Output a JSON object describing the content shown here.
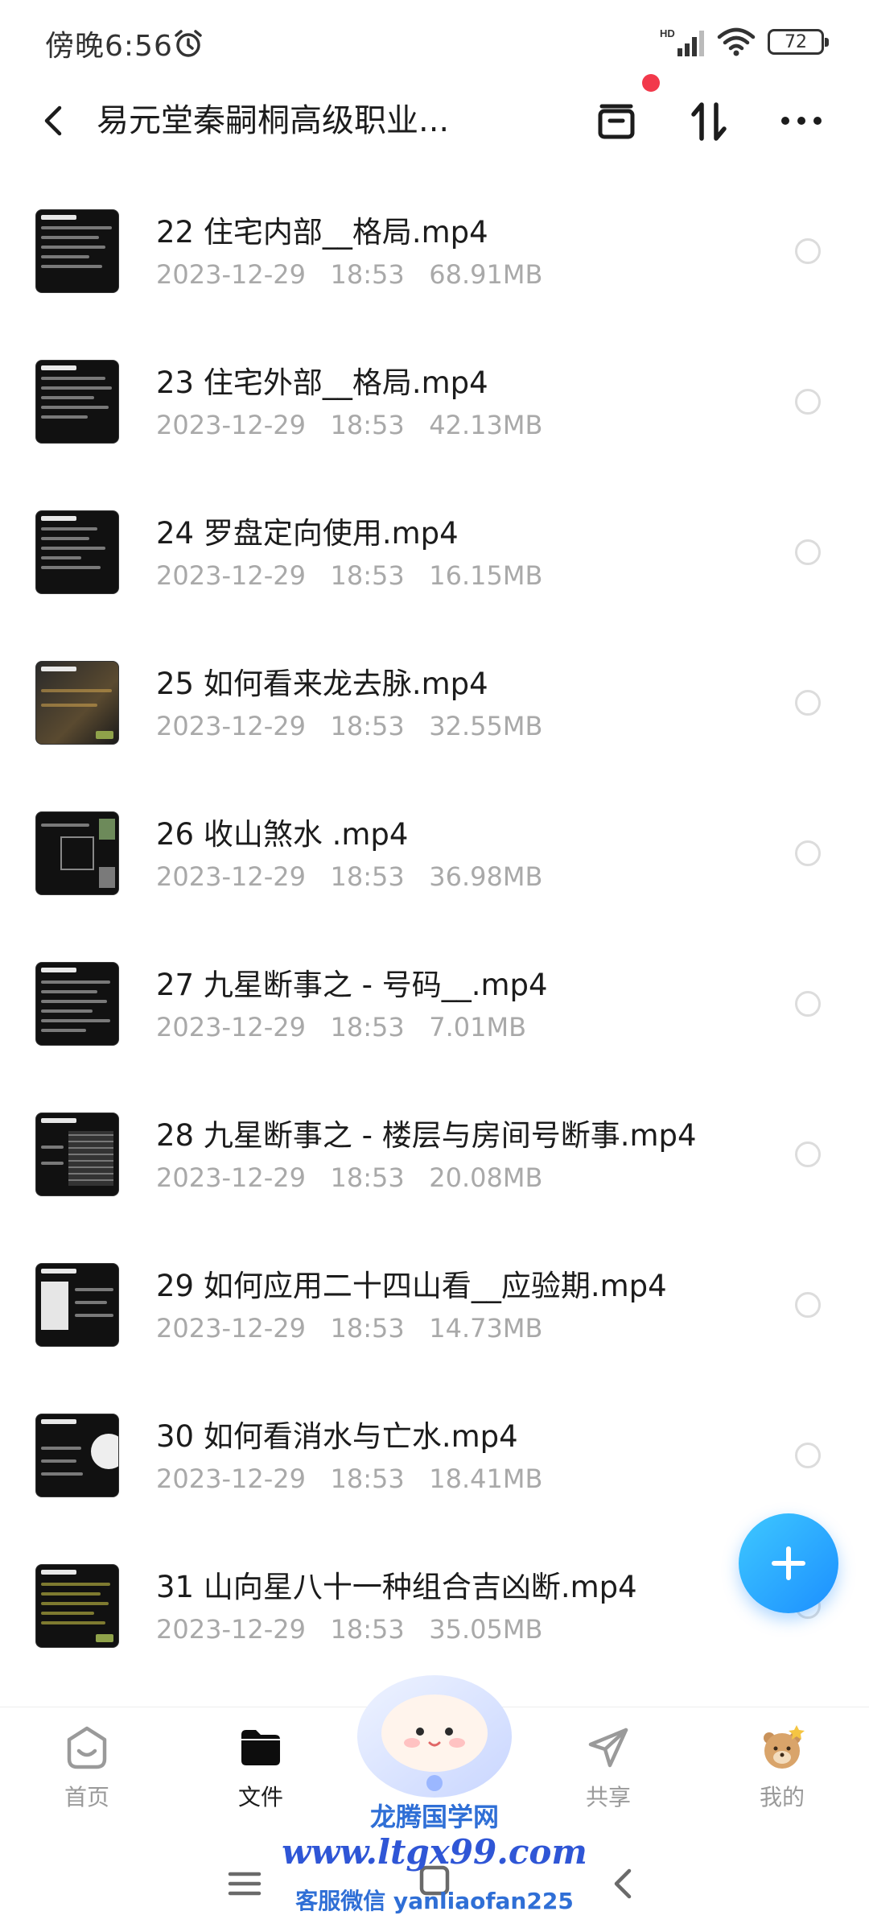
{
  "status_bar": {
    "time": "傍晚6:56",
    "network": "HD",
    "battery": "72"
  },
  "header": {
    "back_icon": "chevron-left-icon",
    "title": "易元堂秦嗣桐高级职业...",
    "actions": [
      "archive-icon",
      "sort-icon",
      "more-icon"
    ]
  },
  "files": [
    {
      "name": "22 住宅内部__格局.mp4",
      "date": "2023-12-29",
      "time": "18:53",
      "size": "68.91MB"
    },
    {
      "name": "23 住宅外部__格局.mp4",
      "date": "2023-12-29",
      "time": "18:53",
      "size": "42.13MB"
    },
    {
      "name": "24 罗盘定向使用.mp4",
      "date": "2023-12-29",
      "time": "18:53",
      "size": "16.15MB"
    },
    {
      "name": "25 如何看来龙去脉.mp4",
      "date": "2023-12-29",
      "time": "18:53",
      "size": "32.55MB"
    },
    {
      "name": "26 收山煞水 .mp4",
      "date": "2023-12-29",
      "time": "18:53",
      "size": "36.98MB"
    },
    {
      "name": "27 九星断事之 - 号码__.mp4",
      "date": "2023-12-29",
      "time": "18:53",
      "size": "7.01MB"
    },
    {
      "name": "28 九星断事之 - 楼层与房间号断事.mp4",
      "date": "2023-12-29",
      "time": "18:53",
      "size": "20.08MB"
    },
    {
      "name": "29 如何应用二十四山看__应验期.mp4",
      "date": "2023-12-29",
      "time": "18:53",
      "size": "14.73MB"
    },
    {
      "name": "30 如何看消水与亡水.mp4",
      "date": "2023-12-29",
      "time": "18:53",
      "size": "18.41MB"
    },
    {
      "name": "31 山向星八十一种组合吉凶断.mp4",
      "date": "2023-12-29",
      "time": "18:53",
      "size": "35.05MB"
    }
  ],
  "fab": {
    "icon": "plus-icon"
  },
  "bottom_nav": {
    "items": [
      {
        "label": "首页",
        "icon": "home-icon"
      },
      {
        "label": "文件",
        "icon": "folder-icon"
      },
      {
        "label": "共享",
        "icon": "send-icon"
      },
      {
        "label": "我的",
        "icon": "avatar-icon"
      }
    ],
    "active": "文件"
  },
  "watermark": {
    "line1": "龙腾国学网",
    "line2": "www.ltgx99.com",
    "line3": "客服微信 yanliaofan225"
  },
  "colors": {
    "accent": "#1c8fff",
    "notification": "#f2394b",
    "meta_text": "#a9a9a9"
  }
}
